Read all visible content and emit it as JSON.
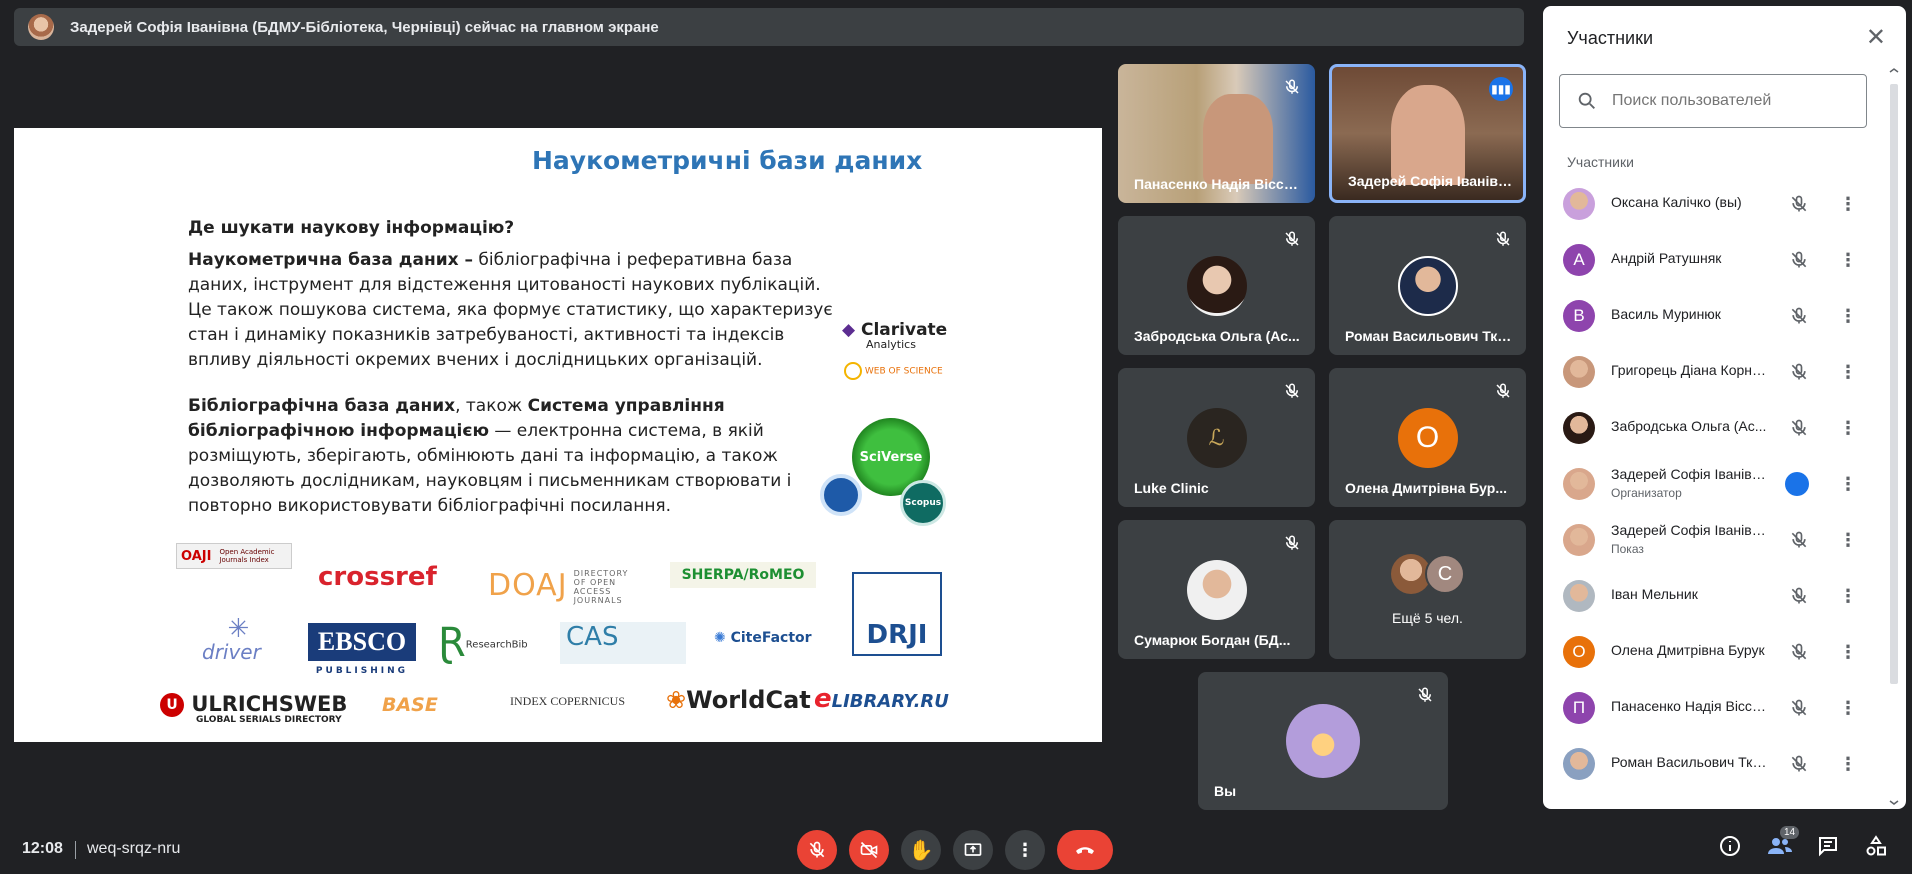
{
  "banner": {
    "text": "Задерей Софія Іванівна (БДМУ-Бібліотека, Чернівці) сейчас на главном экране"
  },
  "slide": {
    "title": "Наукометричні бази даних",
    "question": "Де шукати наукову інформацію?",
    "p1_bold": "Наукометрична база даних –",
    "p1_text": " бібліографічна і реферативна база даних, інструмент для відстеження цитованості наукових публікацій.",
    "p2": "Це також пошукова система, яка формує статистику, що характеризує стан і динаміку показників затребуваності, активності та індексів впливу діяльності окремих вчених і дослідницьких організацій.",
    "p3_bold1": "Бібліографічна база даних",
    "p3_mid": ", також ",
    "p3_bold2": "Система управління бібліографічною інформацією",
    "p3_text": " — електронна система, в якій розміщують, зберігають, обмінюють дані та інформацію, а також дозволяють дослідникам, науковцям і письменникам створювати і повторно використовувати бібліографічні посилання.",
    "logos": {
      "clarivate": "Clarivate",
      "clarivate_sub": "Analytics",
      "wos": "WEB OF SCIENCE",
      "sciverse": "SciVerse",
      "scopus": "Scopus",
      "oaji": "OAJI",
      "oaji_sub": "Open Academic Journals Index",
      "crossref": "crossref",
      "doaj": "DOAJ",
      "doaj_sub": "DIRECTORY OF OPEN ACCESS JOURNALS",
      "sherpa": "SHERPA/RoMEO",
      "drji": "DRJI",
      "driver": "driver",
      "ebsco": "EBSCO",
      "ebsco_sub": "PUBLISHING",
      "researchbib": "ResearchBib",
      "cas": "CAS",
      "citefactor": "CiteFactor",
      "ulrich": "ULRICHSWEB",
      "ulrich_sub": "GLOBAL SERIALS DIRECTORY",
      "base": "BASE",
      "copernicus": "INDEX COPERNICUS",
      "worldcat": "WorldCat",
      "elibrary": "LIBRARY.RU"
    }
  },
  "tiles": [
    {
      "name": "Панасенко Надія Віссар..."
    },
    {
      "name": "Задерей Софія Іванівна..."
    },
    {
      "name": "Забродська Ольга (Ас..."
    },
    {
      "name": "Роман Васильович Тка..."
    },
    {
      "name": "Luke Clinic"
    },
    {
      "name": "Олена Дмитрівна Бур...",
      "initial": "О"
    },
    {
      "name": "Сумарюк Богдан (БД..."
    },
    {
      "name": "Ещё 5 чел.",
      "initial": "С"
    },
    {
      "name": "Вы"
    }
  ],
  "panel": {
    "title": "Участники",
    "search_placeholder": "Поиск пользователей",
    "section": "Участники",
    "people": [
      {
        "name": "Оксана Калічко (вы)"
      },
      {
        "name": "Андрій Ратушняк",
        "initial": "А",
        "color": "#8e44ad"
      },
      {
        "name": "Василь Муринюк",
        "initial": "В",
        "color": "#8e44ad"
      },
      {
        "name": "Григорець Діана Корне..."
      },
      {
        "name": "Забродська Ольга (Ас..."
      },
      {
        "name": "Задерей Софія Іванівн...",
        "sub": "Организатор"
      },
      {
        "name": "Задерей Софія Іванівн...",
        "sub": "Показ"
      },
      {
        "name": "Іван Мельник"
      },
      {
        "name": "Олена Дмитрівна Бурук",
        "initial": "О",
        "color": "#e8710a"
      },
      {
        "name": "Панасенко Надія Віссa...",
        "initial": "П",
        "color": "#8e44ad"
      },
      {
        "name": "Роман Васильович Ткач..."
      }
    ]
  },
  "bottom": {
    "time": "12:08",
    "code": "weq-srqz-nru",
    "badge": "14"
  },
  "colors": {
    "bg": "#202124",
    "red": "#ea4335",
    "blue": "#1a73e8",
    "orange": "#e8710a"
  }
}
